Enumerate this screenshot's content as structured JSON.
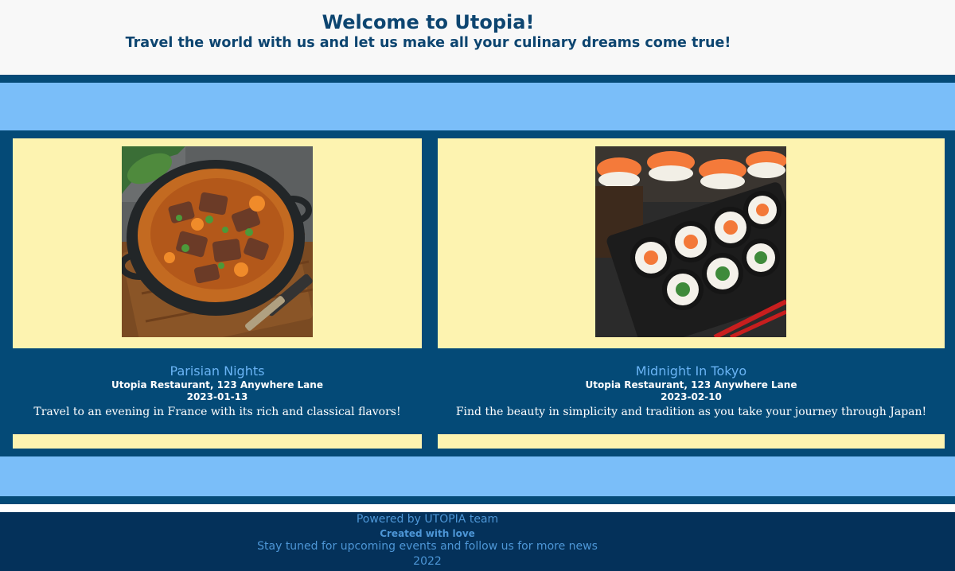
{
  "header": {
    "title": "Welcome to Utopia!",
    "subtitle": "Travel the world with us and let us make all your culinary dreams come true!"
  },
  "events": [
    {
      "title": "Parisian Nights",
      "location": "Utopia Restaurant, 123 Anywhere Lane",
      "date": "2023-01-13",
      "description": "Travel to an evening in France with its rich and classical flavors!",
      "image": "beef-stew-photo"
    },
    {
      "title": "Midnight In Tokyo",
      "location": "Utopia Restaurant, 123 Anywhere Lane",
      "date": "2023-02-10",
      "description": "Find the beauty in simplicity and tradition as you take your journey through Japan!",
      "image": "sushi-platter-photo"
    }
  ],
  "footer": {
    "powered": "Powered by UTOPIA team",
    "created": "Created with love",
    "follow": "Stay tuned for upcoming events and follow us for more news",
    "year": "2022"
  },
  "colors": {
    "navy": "#044a77",
    "sky": "#7abef9",
    "cream": "#fdf3b0",
    "footer": "#04315a"
  }
}
